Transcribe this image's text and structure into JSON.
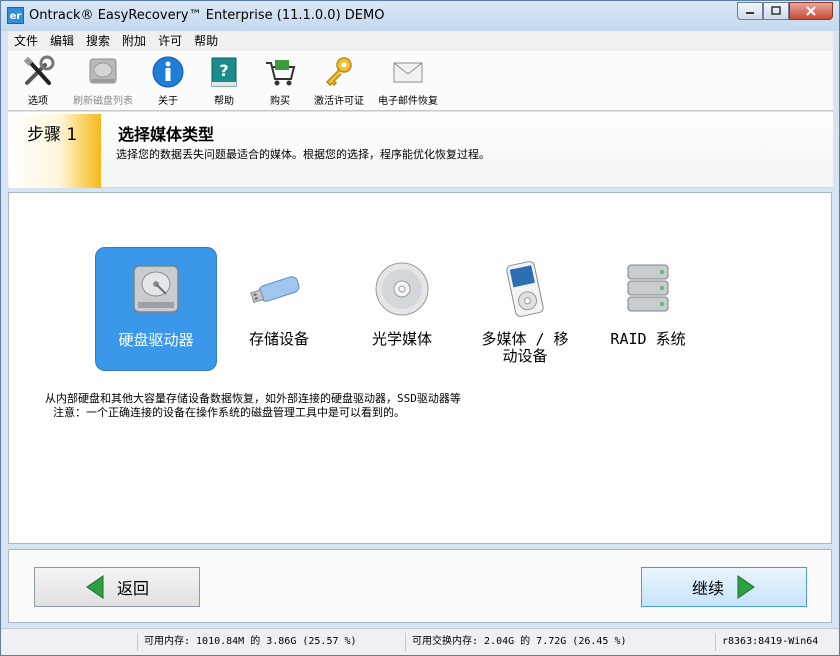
{
  "window": {
    "title": "Ontrack® EasyRecovery™ Enterprise (11.1.0.0) DEMO",
    "icon_text": "er",
    "minimize": "▭",
    "maximize": "□",
    "close": "✕"
  },
  "menu": [
    "文件",
    "编辑",
    "搜索",
    "附加",
    "许可",
    "帮助"
  ],
  "toolbar": [
    {
      "label": "选项",
      "icon": "tools-icon",
      "enabled": true
    },
    {
      "label": "刷新磁盘列表",
      "icon": "disk-refresh-icon",
      "enabled": false
    },
    {
      "label": "关于",
      "icon": "info-icon",
      "enabled": true
    },
    {
      "label": "帮助",
      "icon": "help-book-icon",
      "enabled": true
    },
    {
      "label": "购买",
      "icon": "cart-icon",
      "enabled": true
    },
    {
      "label": "激活许可证",
      "icon": "key-icon",
      "enabled": true
    },
    {
      "label": "电子邮件恢复",
      "icon": "envelope-icon",
      "enabled": true
    }
  ],
  "step": {
    "number": "步骤 1",
    "title": "选择媒体类型",
    "subtitle": "选择您的数据丢失问题最适合的媒体。根据您的选择，程序能优化恢复过程。"
  },
  "media_types": [
    {
      "label": "硬盘驱动器",
      "icon": "hard-drive-icon",
      "selected": true
    },
    {
      "label": "存储设备",
      "icon": "usb-drive-icon",
      "selected": false
    },
    {
      "label": "光学媒体",
      "icon": "optical-disc-icon",
      "selected": false
    },
    {
      "label": "多媒体 / 移\n动设备",
      "icon": "media-player-icon",
      "selected": false
    },
    {
      "label": "RAID 系统",
      "icon": "raid-icon",
      "selected": false
    }
  ],
  "description": {
    "line1": "从内部硬盘和其他大容量存储设备数据恢复，如外部连接的硬盘驱动器，SSD驱动器等",
    "line2": "注意：一个正确连接的设备在操作系统的磁盘管理工具中是可以看到的。"
  },
  "nav": {
    "back_label": "返回",
    "next_label": "继续"
  },
  "status": {
    "memory": "可用内存: 1010.84M 的 3.86G (25.57 %)",
    "swap": "可用交换内存: 2.04G 的 7.72G (26.45 %)",
    "build": "r8363:8419-Win64"
  },
  "colors": {
    "selected_bg": "#3a97ea",
    "next_arrow": "#2ea043",
    "back_arrow": "#2ea043"
  }
}
